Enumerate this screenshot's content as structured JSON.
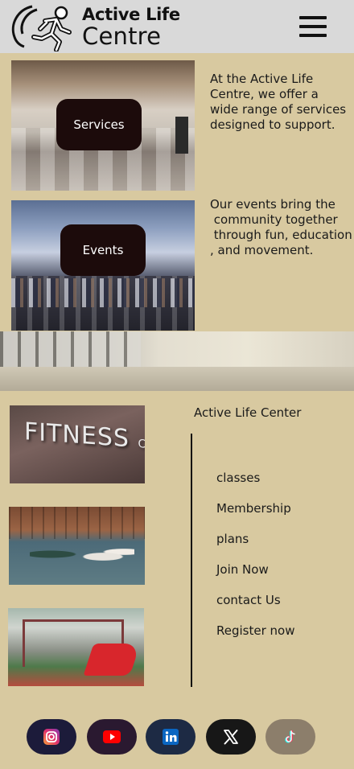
{
  "header": {
    "logo_line1": "Active Life",
    "logo_line2": "Centre"
  },
  "services": {
    "button_label": "Services",
    "description": "At the Active Life\nCentre, we offer a\nwide range of services\ndesigned to support."
  },
  "events": {
    "button_label": "Events",
    "description": "Our events bring the\n community together\n through fun, education\n, and movement."
  },
  "photos": {
    "fitness_sign": "FITNESS",
    "fitness_sign_small": "CENTER"
  },
  "footer": {
    "site_name": "Active Life Center",
    "nav_links": [
      "classes",
      "Membership",
      "plans",
      "Join Now",
      "contact Us",
      "Register now"
    ]
  },
  "social": {
    "icons": [
      "instagram-icon",
      "youtube-icon",
      "linkedin-icon",
      "x-icon",
      "tiktok-icon"
    ]
  },
  "colors": {
    "page_background": "#d8c9a0",
    "header_background": "#d9d9d9",
    "pill_background": "#1c0b0b"
  }
}
